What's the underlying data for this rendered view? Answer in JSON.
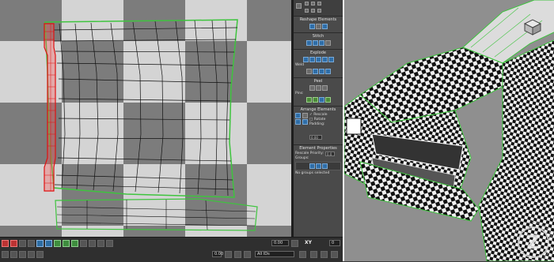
{
  "panel": {
    "reshape_title": "Reshape Elements",
    "stitch_title": "Stitch",
    "explode_title": "Explode",
    "weld_label": "Weld",
    "peel_title": "Peel",
    "pins_label": "Pins:",
    "arrange_title": "Arrange Elements",
    "rescale_label": "Rescale",
    "rotate_label": "Rotate",
    "padding_label": "Padding:",
    "padding_value": "0.00",
    "element_props_title": "Element Properties",
    "rescale_priority_label": "Rescale Priority:",
    "rescale_priority_value": "0.0",
    "groups_label": "Groups:",
    "no_groups": "No groups selected"
  },
  "bottom": {
    "xy_label": "XY",
    "field_left": "0.00",
    "field_right": "0",
    "field_u": "0.00",
    "filter_select": "All IDs"
  },
  "logo": {
    "text": "Z"
  }
}
